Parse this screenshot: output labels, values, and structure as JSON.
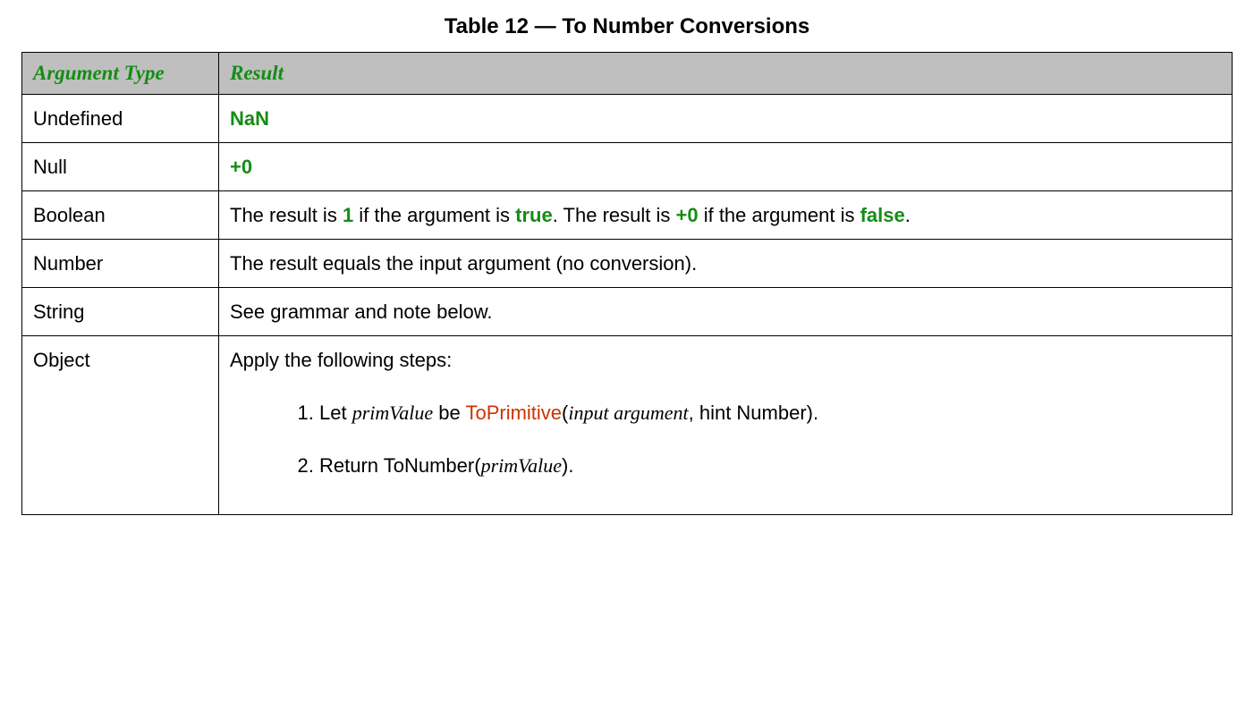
{
  "caption": "Table 12 — To Number Conversions",
  "headers": {
    "arg": "Argument Type",
    "result": "Result"
  },
  "rows": {
    "undefined": {
      "arg": "Undefined",
      "result_nan": "NaN"
    },
    "null": {
      "arg": "Null",
      "result_zero": "+0"
    },
    "boolean": {
      "arg": "Boolean",
      "text1": "The result is ",
      "one": "1",
      "text2": " if the argument is ",
      "true": "true",
      "text3": ". The result is ",
      "zero": "+0",
      "text4": " if the argument is ",
      "false": "false",
      "text5": "."
    },
    "number": {
      "arg": "Number",
      "result": "The result equals the input argument (no conversion)."
    },
    "string": {
      "arg": "String",
      "result": "See grammar and note below."
    },
    "object": {
      "arg": "Object",
      "intro": "Apply the following steps:",
      "step1_a": "Let ",
      "step1_primValue": "primValue",
      "step1_b": " be ",
      "step1_toPrimitive": "ToPrimitive",
      "step1_c": "(",
      "step1_inputArg": "input argument",
      "step1_d": ", hint Number).",
      "step2_a": "Return ToNumber(",
      "step2_primValue": "primValue",
      "step2_b": ")."
    }
  }
}
